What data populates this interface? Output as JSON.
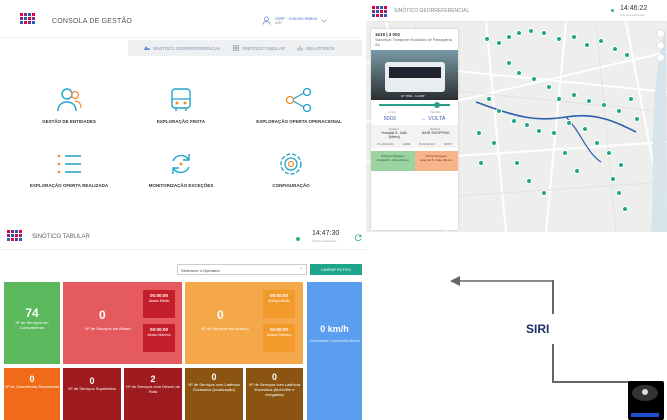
{
  "consola": {
    "title": "CONSOLA DE GESTÃO",
    "user_name": "AMP - Antonio Matos",
    "user_role": "AMP",
    "nav": [
      "SINÓTICO GEORREFERENCIAL",
      "SINÓTICO TABULAR",
      "RELATÓRIOS"
    ],
    "tiles": [
      {
        "label": "GESTÃO DE ENTIDADES",
        "icon": "users-icon"
      },
      {
        "label": "EXPLORAÇÃO FROTA",
        "icon": "bus-icon"
      },
      {
        "label": "EXPLORAÇÃO OFERTA OPERACIONAL",
        "icon": "network-icon"
      },
      {
        "label": "EXPLORAÇÃO OFERTA REALIZADA",
        "icon": "list-icon"
      },
      {
        "label": "MONITORIZAÇÃO EXCEÇÕES",
        "icon": "refresh-icon"
      },
      {
        "label": "CONFIGURAÇÃO",
        "icon": "gear-icon"
      }
    ]
  },
  "geo": {
    "title": "SINÓTICO GEORREFERENCIAL",
    "time": "14:46:22",
    "time_sub": "Última Atualização",
    "card": {
      "line": "1619 | 3 002",
      "operator": "Vianorbus: Transporte Rodoviário de Passageiros SA",
      "plate": "ET 7801 - G AMP",
      "label_line": "Linha",
      "label_dir": "Sentido",
      "line_value": "5003",
      "dir_value": "← VOLTA",
      "origin_label": "Origem",
      "dest_label": "Destino",
      "origin": "Hospital S. João (Metro)",
      "dest": "NAIR SHOPPING",
      "planned_label": "PLANEADO",
      "planned_1": "14:30",
      "planned_2": "14:57",
      "next_label": "Próxima Paragem",
      "prev_label": "Última Paragem",
      "next_stop": "Hospital S. João (Metro)",
      "prev_stop": "Hospital S. João (Metro)"
    }
  },
  "tabular": {
    "title": "SINÓTICO TABULAR",
    "time": "14:47:30",
    "time_sub": "Última Atualização",
    "select_placeholder": "Selecione o Operador",
    "clear_button": "LIMPAR FILTRO",
    "boxes": {
      "cumprimento": {
        "value": "74",
        "label": "Nº de Serviços em Cumprimento"
      },
      "atraso": {
        "value": "0",
        "label": "Nº de Serviços em Atraso"
      },
      "avanco": {
        "value": "0",
        "label": "Nº de Serviços em Avanço"
      },
      "velocidade": {
        "value": "0 km/h",
        "label": "Velocidade Comercial Média"
      },
      "ocorrencias": {
        "value": "0",
        "label": "Nº de Ocorrências Reportadas"
      },
      "suprimidos": {
        "value": "0",
        "label": "Nº de Serviços Suprimidos"
      },
      "desvio": {
        "value": "2",
        "label": "Nº de Serviços com Desvio de Rota"
      },
      "lat_loc": {
        "value": "0",
        "label": "Nº de Serviços com Latência Excessiva (localização)"
      },
      "lat_fecho": {
        "value": "0",
        "label": "Nº de Serviços com Latência Excessiva (fecho/fim e chegadas)"
      }
    },
    "atraso_medio": {
      "value": "00:00:00",
      "label": "Atraso Médio"
    },
    "atraso_maximo": {
      "value": "00:00:00",
      "label": "Atraso Máximo"
    },
    "avanco_medio": {
      "value": "00:00:00",
      "label": "Avanço Médio"
    },
    "avanco_maximo": {
      "value": "00:00:00",
      "label": "Avanço Máximo"
    }
  },
  "siri": {
    "label": "SIRI"
  },
  "colors": {
    "green": "#5cb85c",
    "red": "#e55a5f",
    "orange": "#f5a84a",
    "blue": "#5b9ef0",
    "teal": "#1fa58c"
  }
}
